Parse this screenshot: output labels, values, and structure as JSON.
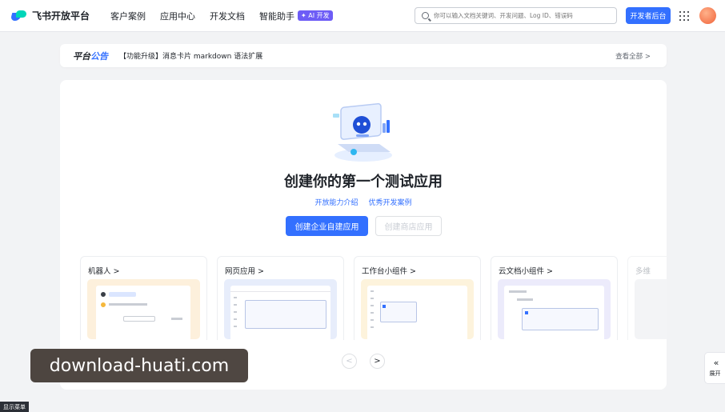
{
  "nav": {
    "brand": "飞书开放平台",
    "items": [
      "客户案例",
      "应用中心",
      "开发文档",
      "智能助手"
    ],
    "ai_badge": "✦ AI 开发",
    "search_placeholder": "你可以输入文档关键词、开发问题、Log ID、错误码",
    "dev_console": "开发者后台"
  },
  "announcement": {
    "tag_part1": "平台",
    "tag_part2": "公告",
    "text": "【功能升级】消息卡片 markdown 语法扩展",
    "view_all": "查看全部 >"
  },
  "hero": {
    "title": "创建你的第一个测试应用",
    "link1": "开放能力介绍",
    "link2": "优秀开发案例",
    "primary_button": "创建企业自建应用",
    "secondary_button": "创建商店应用"
  },
  "app_types": [
    {
      "title": "机器人 >",
      "tint": "#fdf0dc"
    },
    {
      "title": "网页应用 >",
      "tint": "#e7edfb"
    },
    {
      "title": "工作台小组件 >",
      "tint": "#fdf3dc"
    },
    {
      "title": "云文档小组件 >",
      "tint": "#ecebfb"
    },
    {
      "title": "多维",
      "tint": "#f3f4f6"
    }
  ],
  "pager": {
    "prev": "<",
    "next": ">"
  },
  "expand": {
    "chevron": "«",
    "label": "展开"
  },
  "watermark": "download-huati.com",
  "show_menu": "显示菜单",
  "colors": {
    "primary": "#3370ff",
    "ai": "#6d5cf6"
  }
}
